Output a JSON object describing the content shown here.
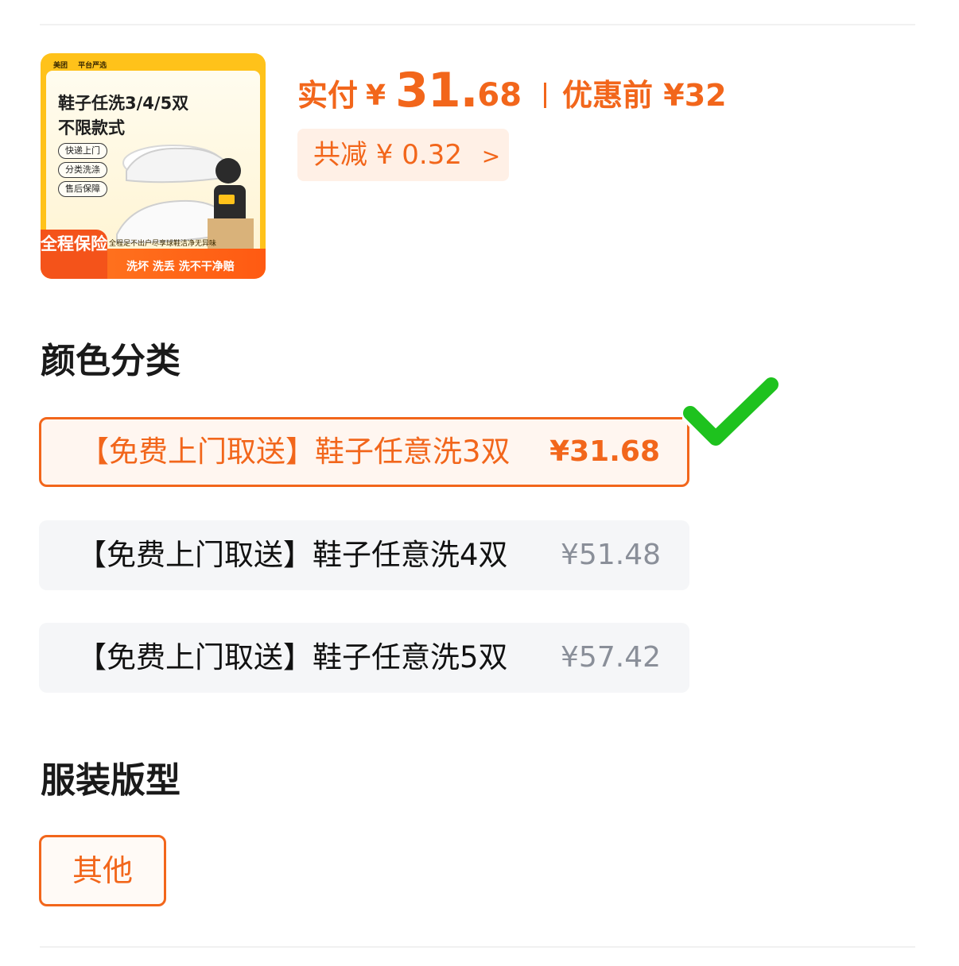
{
  "product": {
    "thumbnail": {
      "brand": "美团",
      "brand_tag": "平台严选",
      "title": "鞋子任洗3/4/5双 不限款式",
      "tags": [
        "快递上门",
        "分类洗涤",
        "售后保障"
      ],
      "badge": "全程保险",
      "small_text": "全程足不出户尽享球鞋洁净无异味",
      "banner_text": "洗坏 洗丢 洗不干净赔"
    },
    "pay_label": "实付",
    "currency": "¥",
    "pay_integer": "31.",
    "pay_decimal": "68",
    "before_label": "优惠前 ¥32",
    "discount_label": "共减 ¥ 0.32",
    "discount_chevron": ">"
  },
  "color_section": {
    "title": "颜色分类",
    "options": [
      {
        "label": "【免费上门取送】鞋子任意洗3双",
        "price": "¥31.68",
        "selected": true
      },
      {
        "label": "【免费上门取送】鞋子任意洗4双",
        "price": "¥51.48",
        "selected": false
      },
      {
        "label": "【免费上门取送】鞋子任意洗5双",
        "price": "¥57.42",
        "selected": false
      }
    ]
  },
  "fit_section": {
    "title": "服装版型",
    "options": [
      {
        "label": "其他",
        "selected": true
      }
    ]
  },
  "colors": {
    "accent": "#f2661b",
    "check": "#1ec21e",
    "option_bg": "#f5f6f8"
  },
  "icons": {
    "selected_marker": "checkmark-icon",
    "discount_arrow": "chevron-right-icon"
  }
}
